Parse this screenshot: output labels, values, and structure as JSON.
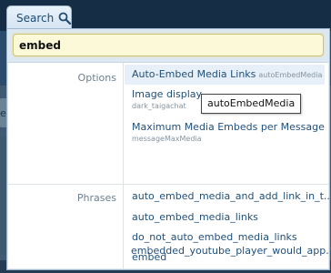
{
  "search_tab": {
    "label": "Search",
    "icon": "magnifier-icon"
  },
  "search": {
    "value": "embed"
  },
  "background": {
    "left_snippet": "ed"
  },
  "groups": [
    {
      "label": "Options",
      "items": [
        {
          "title": "Auto-Embed Media Links",
          "id": "autoEmbedMedia"
        },
        {
          "title": "Image display",
          "id": "dark_taigachat"
        },
        {
          "title": "Maximum Media Embeds per Message",
          "id": "messageMaxMedia"
        }
      ]
    },
    {
      "label": "Phrases",
      "items": [
        {
          "title": "auto_embed_media_and_add_link_in_t..."
        },
        {
          "title": "auto_embed_media_links"
        },
        {
          "title": "do_not_auto_embed_media_links"
        },
        {
          "title": "embed"
        },
        {
          "title": "embedded_youtube_player_would_app..."
        }
      ]
    }
  ],
  "tooltip": {
    "text": "autoEmbedMedia"
  },
  "colors": {
    "accent": "#1f4f7a",
    "highlight": "#fbf9d8",
    "panel": "#dce8f3"
  }
}
